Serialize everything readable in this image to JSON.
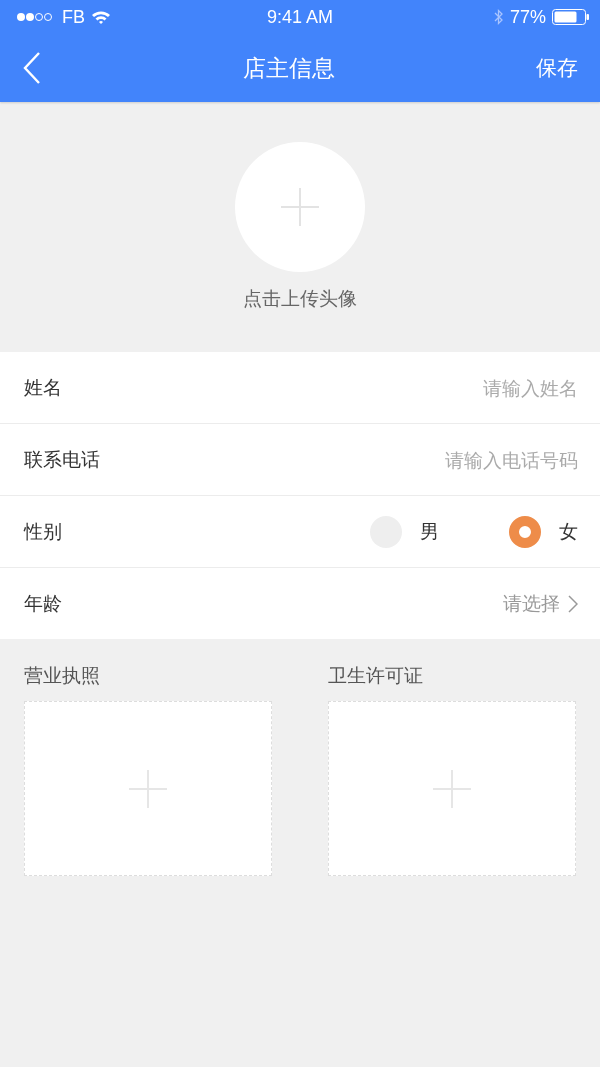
{
  "status_bar": {
    "carrier": "FB",
    "time": "9:41 AM",
    "battery": "77%"
  },
  "nav": {
    "title": "店主信息",
    "action": "保存"
  },
  "avatar": {
    "label": "点击上传头像"
  },
  "fields": [
    {
      "kind": "input",
      "label": "姓名",
      "placeholder": "请输入姓名"
    },
    {
      "kind": "input",
      "label": "联系电话",
      "placeholder": "请输入电话号码"
    },
    {
      "kind": "radio",
      "label": "性别",
      "options": [
        {
          "label": "男",
          "selected": false
        },
        {
          "label": "女",
          "selected": true
        }
      ]
    },
    {
      "kind": "select",
      "label": "年龄",
      "placeholder": "请选择"
    }
  ],
  "uploads": [
    {
      "label": "营业执照"
    },
    {
      "label": "卫生许可证"
    }
  ]
}
